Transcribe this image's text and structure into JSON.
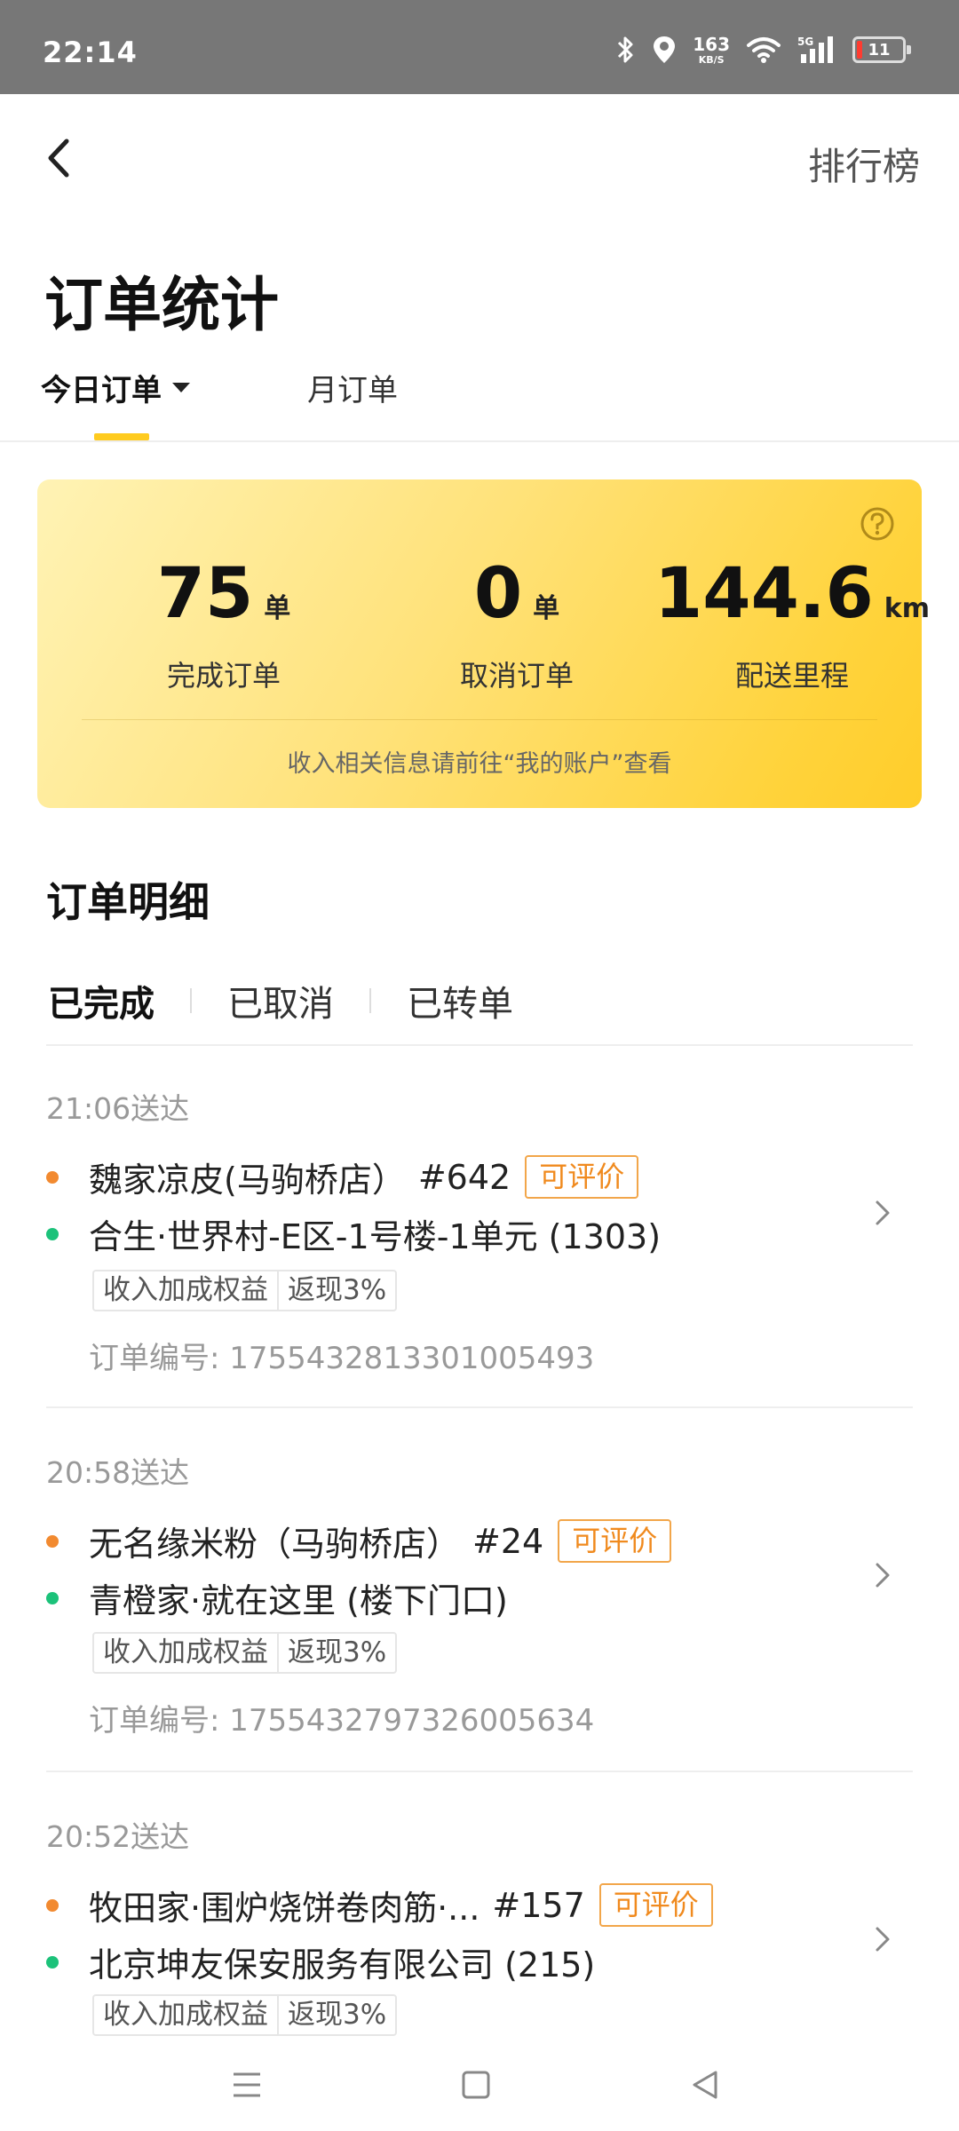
{
  "status_bar": {
    "time": "22:14",
    "net_speed": "163",
    "net_unit": "KB/S",
    "battery": "11",
    "icons": [
      "bluetooth-icon",
      "location-icon",
      "wifi-icon",
      "signal-5g-icon",
      "battery-icon"
    ]
  },
  "header": {
    "back_icon": "chevron-left-icon",
    "ranking": "排行榜",
    "title": "订单统计"
  },
  "period_tabs": [
    {
      "label": "今日订单",
      "active": true
    },
    {
      "label": "月订单",
      "active": false
    }
  ],
  "summary": {
    "completed": {
      "value": "75",
      "unit": "单",
      "label": "完成订单"
    },
    "cancelled": {
      "value": "0",
      "unit": "单",
      "label": "取消订单"
    },
    "distance": {
      "value": "144.6",
      "unit": "km",
      "label": "配送里程"
    },
    "note": "收入相关信息请前往“我的账户”查看",
    "accent_color": "#ffcd2a"
  },
  "detail": {
    "title": "订单明细",
    "tabs": [
      "已完成",
      "已取消",
      "已转单"
    ],
    "active_tab": "已完成"
  },
  "orders": [
    {
      "time": "21:06送达",
      "store": "魏家凉皮(马驹桥店）",
      "number": "#642",
      "badge": "可评价",
      "address": "合生·世界村-E区-1号楼-1单元 (1303)",
      "benefit_tag": "收入加成权益",
      "benefit_value": "返现3%",
      "order_no": "订单编号: 1755432813301005493"
    },
    {
      "time": "20:58送达",
      "store": "无名缘米粉（马驹桥店）",
      "number": "#24",
      "badge": "可评价",
      "address": "青橙家·就在这里 (楼下门口)",
      "benefit_tag": "收入加成权益",
      "benefit_value": "返现3%",
      "order_no": "订单编号: 1755432797326005634"
    },
    {
      "time": "20:52送达",
      "store": "牧田家·围炉烧饼卷肉筋·...",
      "number": "#157",
      "badge": "可评价",
      "address": "北京坤友保安服务有限公司 (215)",
      "benefit_tag": "收入加成权益",
      "benefit_value": "返现3%"
    }
  ]
}
